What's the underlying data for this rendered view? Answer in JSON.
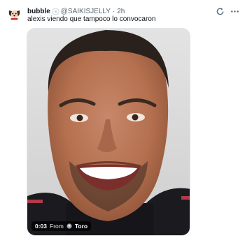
{
  "tweet": {
    "display_name": "bubble",
    "handle": "@SAIKISJELLY",
    "separator": "·",
    "time": "2h",
    "text": "alexis viendo que tampoco lo convocaron"
  },
  "media": {
    "duration": "0:03",
    "from_label": "From",
    "source_name": "Toro"
  },
  "colors": {
    "text_primary": "#0f1419",
    "text_secondary": "#536471"
  }
}
